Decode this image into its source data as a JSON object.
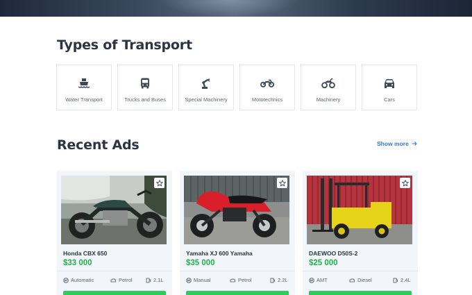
{
  "sections": {
    "types_title": "Types of Transport",
    "ads_title": "Recent Ads",
    "show_more": "Show more"
  },
  "transport_types": [
    {
      "label": "Water Transport",
      "icon": "ship-icon"
    },
    {
      "label": "Trucks and Buses",
      "icon": "bus-icon"
    },
    {
      "label": "Special Machinery",
      "icon": "robot-arm-icon"
    },
    {
      "label": "Mototechnics",
      "icon": "motorcycle-icon"
    },
    {
      "label": "Machinery",
      "icon": "quad-bike-icon"
    },
    {
      "label": "Cars",
      "icon": "car-icon"
    }
  ],
  "ads": [
    {
      "title": "Honda CBX 650",
      "price": "$33 000",
      "transmission": "Automatic",
      "fuel": "Petrol",
      "engine": "2.1L"
    },
    {
      "title": "Yamaha XJ 600 Yamaha",
      "price": "$35 000",
      "transmission": "Manual",
      "fuel": "Petrol",
      "engine": "2.2L"
    },
    {
      "title": "DAEWOO D50S-2",
      "price": "$25 000",
      "transmission": "AMT",
      "fuel": "Diesel",
      "engine": "2.4L"
    }
  ],
  "colors": {
    "accent_link": "#2f7bd6",
    "price_green": "#22b24c",
    "button_green": "#2ecc5b",
    "card_bg": "#f2f6fb"
  }
}
